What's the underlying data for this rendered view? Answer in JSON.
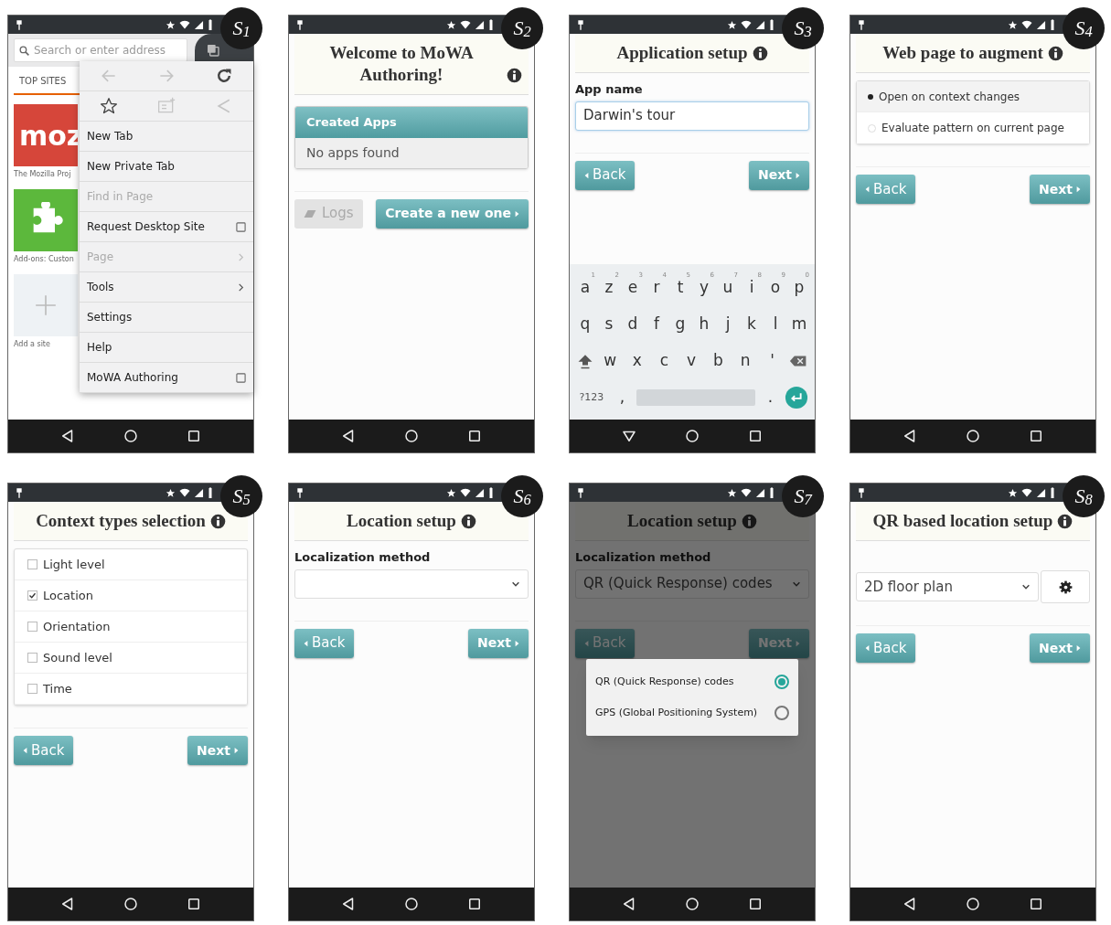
{
  "screens": [
    {
      "kind": "browser",
      "label": "S$_{1}$",
      "keyboard_open": false,
      "search": {
        "placeholder": "Search or enter address"
      },
      "tab": {
        "label": "TOP SITES",
        "selected": true
      },
      "tiles": [
        {
          "kind": "logo",
          "text": "moz",
          "caption": "The Mozilla Proj",
          "color": "#d6463a"
        },
        {
          "kind": "puzzle",
          "caption": "Add-ons: Custon",
          "color": "#5cb83c"
        },
        {
          "kind": "add",
          "caption": "Add a site",
          "color": "#eef2f5"
        }
      ],
      "menu_icons": [
        {
          "kind": "back",
          "disabled": true
        },
        {
          "kind": "forward",
          "disabled": true
        },
        {
          "kind": "reload",
          "disabled": false
        },
        {
          "kind": "bookmark",
          "disabled": false
        },
        {
          "kind": "reading-list",
          "disabled": true
        },
        {
          "kind": "share",
          "disabled": true
        }
      ],
      "menu": [
        {
          "label": "New Tab",
          "kind": "plain",
          "disabled": false
        },
        {
          "label": "New Private Tab",
          "kind": "plain",
          "disabled": false
        },
        {
          "label": "Find in Page",
          "kind": "plain",
          "disabled": true
        },
        {
          "label": "Request Desktop Site",
          "kind": "checkbox",
          "disabled": false,
          "checked": false
        },
        {
          "label": "Page",
          "kind": "submenu",
          "disabled": true
        },
        {
          "label": "Tools",
          "kind": "submenu",
          "disabled": false
        },
        {
          "label": "Settings",
          "kind": "plain",
          "disabled": false
        },
        {
          "label": "Help",
          "kind": "plain",
          "disabled": false
        },
        {
          "label": "MoWA Authoring",
          "kind": "checkbox",
          "disabled": false,
          "checked": false
        }
      ]
    },
    {
      "kind": "app",
      "label": "S$_{2}$",
      "keyboard_open": false,
      "blocks": [
        {
          "kind": "title",
          "text": "Welcome to MoWA Authoring!"
        },
        {
          "kind": "panel",
          "heading": "Created Apps",
          "body": "No apps found"
        },
        {
          "kind": "buttons",
          "buttons": [
            {
              "kind": "secondary",
              "label": "Logs"
            },
            {
              "kind": "primary",
              "label": "Create a new one"
            }
          ]
        }
      ]
    },
    {
      "kind": "app",
      "label": "S$_{3}$",
      "keyboard_open": true,
      "blocks": [
        {
          "kind": "title",
          "text": "Application setup"
        },
        {
          "kind": "field",
          "label": "App name",
          "value": "Darwin's tour"
        },
        {
          "kind": "buttons",
          "buttons": [
            {
              "kind": "back",
              "label": "Back"
            },
            {
              "kind": "next",
              "label": "Next"
            }
          ]
        },
        {
          "kind": "keyboard",
          "rows": [
            [
              {
                "kind": "letter",
                "label": "a",
                "hint": "1"
              },
              {
                "kind": "letter",
                "label": "z",
                "hint": "2"
              },
              {
                "kind": "letter",
                "label": "e",
                "hint": "3"
              },
              {
                "kind": "letter",
                "label": "r",
                "hint": "4"
              },
              {
                "kind": "letter",
                "label": "t",
                "hint": "5"
              },
              {
                "kind": "letter",
                "label": "y",
                "hint": "6"
              },
              {
                "kind": "letter",
                "label": "u",
                "hint": "7"
              },
              {
                "kind": "letter",
                "label": "i",
                "hint": "8"
              },
              {
                "kind": "letter",
                "label": "o",
                "hint": "9"
              },
              {
                "kind": "letter",
                "label": "p",
                "hint": "0"
              }
            ],
            [
              {
                "kind": "letter",
                "label": "q"
              },
              {
                "kind": "letter",
                "label": "s"
              },
              {
                "kind": "letter",
                "label": "d"
              },
              {
                "kind": "letter",
                "label": "f"
              },
              {
                "kind": "letter",
                "label": "g"
              },
              {
                "kind": "letter",
                "label": "h"
              },
              {
                "kind": "letter",
                "label": "j"
              },
              {
                "kind": "letter",
                "label": "k"
              },
              {
                "kind": "letter",
                "label": "l"
              },
              {
                "kind": "letter",
                "label": "m"
              }
            ],
            [
              {
                "kind": "shift"
              },
              {
                "kind": "letter",
                "label": "w"
              },
              {
                "kind": "letter",
                "label": "x"
              },
              {
                "kind": "letter",
                "label": "c"
              },
              {
                "kind": "letter",
                "label": "v"
              },
              {
                "kind": "letter",
                "label": "b"
              },
              {
                "kind": "letter",
                "label": "n"
              },
              {
                "kind": "letter",
                "label": "'"
              },
              {
                "kind": "backspace"
              }
            ],
            [
              {
                "kind": "symbols",
                "label": "?123"
              },
              {
                "kind": "letter",
                "label": ","
              },
              {
                "kind": "space"
              },
              {
                "kind": "letter",
                "label": "."
              },
              {
                "kind": "enter"
              }
            ]
          ]
        }
      ]
    },
    {
      "kind": "app",
      "label": "S$_{4}$",
      "keyboard_open": false,
      "blocks": [
        {
          "kind": "title",
          "text": "Web page to augment"
        },
        {
          "kind": "radio_list",
          "options": [
            {
              "label": "Open on context changes",
              "selected": true
            },
            {
              "label": "Evaluate pattern on current page",
              "selected": false
            }
          ]
        },
        {
          "kind": "buttons",
          "buttons": [
            {
              "kind": "back",
              "label": "Back"
            },
            {
              "kind": "next",
              "label": "Next"
            }
          ]
        }
      ]
    },
    {
      "kind": "app",
      "label": "S$_{5}$",
      "keyboard_open": false,
      "blocks": [
        {
          "kind": "title",
          "text": "Context types selection"
        },
        {
          "kind": "check_list",
          "items": [
            {
              "label": "Light level",
              "checked": false
            },
            {
              "label": "Location",
              "checked": true
            },
            {
              "label": "Orientation",
              "checked": false
            },
            {
              "label": "Sound level",
              "checked": false
            },
            {
              "label": "Time",
              "checked": false
            }
          ]
        },
        {
          "kind": "buttons",
          "buttons": [
            {
              "kind": "back",
              "label": "Back"
            },
            {
              "kind": "next",
              "label": "Next"
            }
          ]
        }
      ]
    },
    {
      "kind": "app",
      "label": "S$_{6}$",
      "keyboard_open": false,
      "blocks": [
        {
          "kind": "title",
          "text": "Location setup"
        },
        {
          "kind": "select",
          "label": "Localization method"
        },
        {
          "kind": "buttons",
          "buttons": [
            {
              "kind": "back",
              "label": "Back"
            },
            {
              "kind": "next",
              "label": "Next"
            }
          ]
        }
      ]
    },
    {
      "kind": "app",
      "label": "S$_{7}$",
      "keyboard_open": false,
      "blocks": [
        {
          "kind": "title",
          "text": "Location setup"
        },
        {
          "kind": "select",
          "label": "Localization method",
          "value": "QR (Quick Response) codes"
        },
        {
          "kind": "buttons",
          "buttons": [
            {
              "kind": "back",
              "label": "Back"
            },
            {
              "kind": "next",
              "label": "Next"
            }
          ]
        }
      ],
      "dialog": {
        "options": [
          {
            "label": "QR (Quick Response) codes",
            "selected": true
          },
          {
            "label": "GPS (Global Positioning System)",
            "selected": false
          }
        ]
      }
    },
    {
      "kind": "app",
      "label": "S$_{8}$",
      "keyboard_open": false,
      "blocks": [
        {
          "kind": "title",
          "text": "QR based location setup"
        },
        {
          "kind": "select",
          "value": "2D floor plan",
          "gear_button": true
        },
        {
          "kind": "buttons",
          "buttons": [
            {
              "kind": "back",
              "label": "Back"
            },
            {
              "kind": "next",
              "label": "Next"
            }
          ]
        }
      ]
    }
  ]
}
